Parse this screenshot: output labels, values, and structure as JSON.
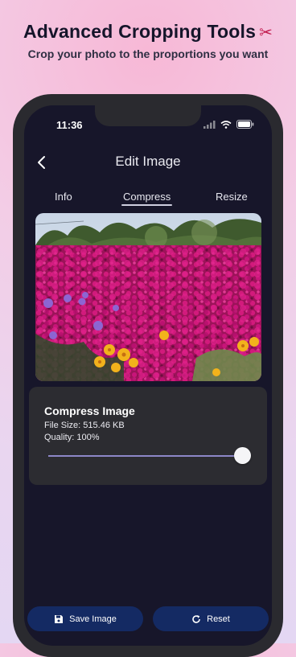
{
  "promo": {
    "title": "Advanced Cropping Tools",
    "title_icon": "scissors-icon",
    "subtitle": "Crop your photo to the proportions you want"
  },
  "status_bar": {
    "time": "11:36",
    "icons": [
      "signal-icon",
      "wifi-icon",
      "battery-icon"
    ]
  },
  "nav": {
    "back_icon": "chevron-left-icon",
    "title": "Edit Image"
  },
  "tabs": [
    {
      "label": "Info",
      "active": false
    },
    {
      "label": "Compress",
      "active": true
    },
    {
      "label": "Resize",
      "active": false
    }
  ],
  "image": {
    "description_icon": "flower-photo"
  },
  "compress": {
    "title": "Compress Image",
    "file_size": "File Size: 515.46 KB",
    "quality": "Quality: 100%",
    "quality_value": 1.0
  },
  "actions": {
    "save_label": "Save Image",
    "save_icon": "floppy-disk-icon",
    "reset_label": "Reset",
    "reset_icon": "refresh-icon"
  },
  "colors": {
    "screen_bg": "#17162a",
    "card_bg": "#2c2c31",
    "button_bg": "#142a63",
    "slider_track": "#8d87c8"
  }
}
